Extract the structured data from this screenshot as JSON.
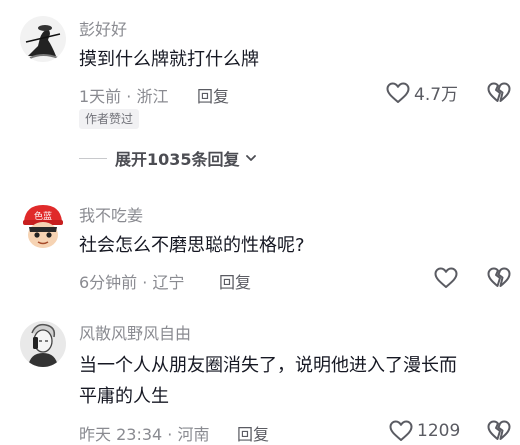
{
  "comments": [
    {
      "username": "彭好好",
      "avatar_icon": "ink-swordsman-avatar-icon",
      "content": [
        "摸到什么牌就打什么牌"
      ],
      "meta": "1天前 · 浙江",
      "reply_label": "回复",
      "likes": "4.7万",
      "badge": "作者赞过",
      "expand_label": "展开1035条回复"
    },
    {
      "username": "我不吃姜",
      "avatar_icon": "cartoon-boy-red-cap-avatar-icon",
      "avatar_cap_text": "色蓝",
      "content": [
        "社会怎么不磨思聪的性格呢?"
      ],
      "meta": "6分钟前 · 辽宁",
      "reply_label": "回复",
      "likes": ""
    },
    {
      "username": "风散风野风自由",
      "avatar_icon": "sketch-man-phone-avatar-icon",
      "content": [
        "当一个人从朋友圈消失了，说明他进入了漫长而",
        "平庸的人生"
      ],
      "meta": "昨天 23:34 · 河南",
      "reply_label": "回复",
      "likes": "1209"
    }
  ],
  "colors": {
    "primary_text": "#161823",
    "secondary_text": "#8a8b91",
    "icon_stroke": "#5a5b62",
    "badge_bg": "#f1f1f3"
  }
}
